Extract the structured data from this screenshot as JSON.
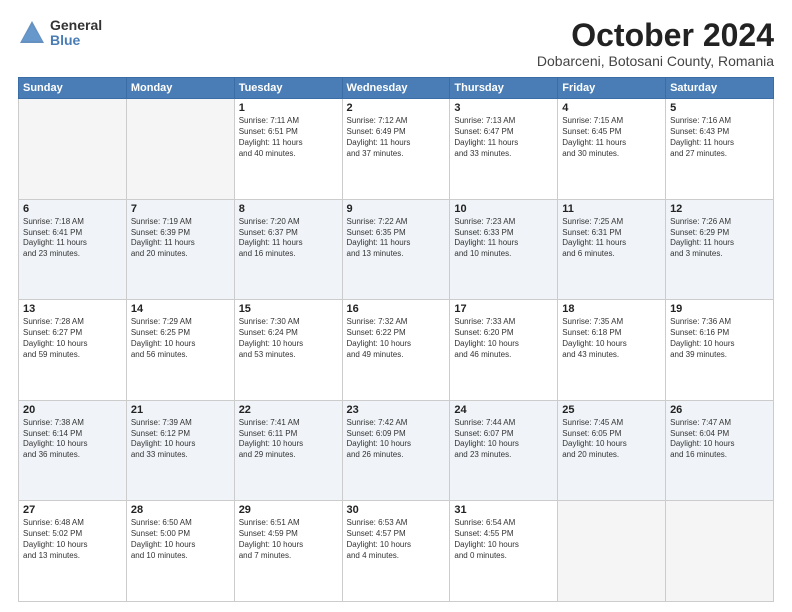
{
  "logo": {
    "general": "General",
    "blue": "Blue"
  },
  "title": {
    "month": "October 2024",
    "location": "Dobarceni, Botosani County, Romania"
  },
  "weekdays": [
    "Sunday",
    "Monday",
    "Tuesday",
    "Wednesday",
    "Thursday",
    "Friday",
    "Saturday"
  ],
  "weeks": [
    [
      {
        "day": "",
        "info": ""
      },
      {
        "day": "",
        "info": ""
      },
      {
        "day": "1",
        "info": "Sunrise: 7:11 AM\nSunset: 6:51 PM\nDaylight: 11 hours\nand 40 minutes."
      },
      {
        "day": "2",
        "info": "Sunrise: 7:12 AM\nSunset: 6:49 PM\nDaylight: 11 hours\nand 37 minutes."
      },
      {
        "day": "3",
        "info": "Sunrise: 7:13 AM\nSunset: 6:47 PM\nDaylight: 11 hours\nand 33 minutes."
      },
      {
        "day": "4",
        "info": "Sunrise: 7:15 AM\nSunset: 6:45 PM\nDaylight: 11 hours\nand 30 minutes."
      },
      {
        "day": "5",
        "info": "Sunrise: 7:16 AM\nSunset: 6:43 PM\nDaylight: 11 hours\nand 27 minutes."
      }
    ],
    [
      {
        "day": "6",
        "info": "Sunrise: 7:18 AM\nSunset: 6:41 PM\nDaylight: 11 hours\nand 23 minutes."
      },
      {
        "day": "7",
        "info": "Sunrise: 7:19 AM\nSunset: 6:39 PM\nDaylight: 11 hours\nand 20 minutes."
      },
      {
        "day": "8",
        "info": "Sunrise: 7:20 AM\nSunset: 6:37 PM\nDaylight: 11 hours\nand 16 minutes."
      },
      {
        "day": "9",
        "info": "Sunrise: 7:22 AM\nSunset: 6:35 PM\nDaylight: 11 hours\nand 13 minutes."
      },
      {
        "day": "10",
        "info": "Sunrise: 7:23 AM\nSunset: 6:33 PM\nDaylight: 11 hours\nand 10 minutes."
      },
      {
        "day": "11",
        "info": "Sunrise: 7:25 AM\nSunset: 6:31 PM\nDaylight: 11 hours\nand 6 minutes."
      },
      {
        "day": "12",
        "info": "Sunrise: 7:26 AM\nSunset: 6:29 PM\nDaylight: 11 hours\nand 3 minutes."
      }
    ],
    [
      {
        "day": "13",
        "info": "Sunrise: 7:28 AM\nSunset: 6:27 PM\nDaylight: 10 hours\nand 59 minutes."
      },
      {
        "day": "14",
        "info": "Sunrise: 7:29 AM\nSunset: 6:25 PM\nDaylight: 10 hours\nand 56 minutes."
      },
      {
        "day": "15",
        "info": "Sunrise: 7:30 AM\nSunset: 6:24 PM\nDaylight: 10 hours\nand 53 minutes."
      },
      {
        "day": "16",
        "info": "Sunrise: 7:32 AM\nSunset: 6:22 PM\nDaylight: 10 hours\nand 49 minutes."
      },
      {
        "day": "17",
        "info": "Sunrise: 7:33 AM\nSunset: 6:20 PM\nDaylight: 10 hours\nand 46 minutes."
      },
      {
        "day": "18",
        "info": "Sunrise: 7:35 AM\nSunset: 6:18 PM\nDaylight: 10 hours\nand 43 minutes."
      },
      {
        "day": "19",
        "info": "Sunrise: 7:36 AM\nSunset: 6:16 PM\nDaylight: 10 hours\nand 39 minutes."
      }
    ],
    [
      {
        "day": "20",
        "info": "Sunrise: 7:38 AM\nSunset: 6:14 PM\nDaylight: 10 hours\nand 36 minutes."
      },
      {
        "day": "21",
        "info": "Sunrise: 7:39 AM\nSunset: 6:12 PM\nDaylight: 10 hours\nand 33 minutes."
      },
      {
        "day": "22",
        "info": "Sunrise: 7:41 AM\nSunset: 6:11 PM\nDaylight: 10 hours\nand 29 minutes."
      },
      {
        "day": "23",
        "info": "Sunrise: 7:42 AM\nSunset: 6:09 PM\nDaylight: 10 hours\nand 26 minutes."
      },
      {
        "day": "24",
        "info": "Sunrise: 7:44 AM\nSunset: 6:07 PM\nDaylight: 10 hours\nand 23 minutes."
      },
      {
        "day": "25",
        "info": "Sunrise: 7:45 AM\nSunset: 6:05 PM\nDaylight: 10 hours\nand 20 minutes."
      },
      {
        "day": "26",
        "info": "Sunrise: 7:47 AM\nSunset: 6:04 PM\nDaylight: 10 hours\nand 16 minutes."
      }
    ],
    [
      {
        "day": "27",
        "info": "Sunrise: 6:48 AM\nSunset: 5:02 PM\nDaylight: 10 hours\nand 13 minutes."
      },
      {
        "day": "28",
        "info": "Sunrise: 6:50 AM\nSunset: 5:00 PM\nDaylight: 10 hours\nand 10 minutes."
      },
      {
        "day": "29",
        "info": "Sunrise: 6:51 AM\nSunset: 4:59 PM\nDaylight: 10 hours\nand 7 minutes."
      },
      {
        "day": "30",
        "info": "Sunrise: 6:53 AM\nSunset: 4:57 PM\nDaylight: 10 hours\nand 4 minutes."
      },
      {
        "day": "31",
        "info": "Sunrise: 6:54 AM\nSunset: 4:55 PM\nDaylight: 10 hours\nand 0 minutes."
      },
      {
        "day": "",
        "info": ""
      },
      {
        "day": "",
        "info": ""
      }
    ]
  ]
}
